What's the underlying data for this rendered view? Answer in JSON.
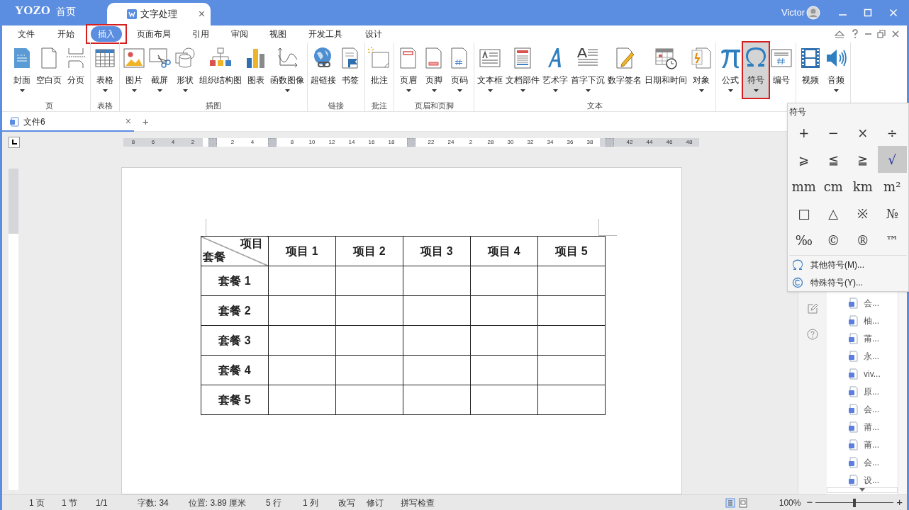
{
  "title_bar": {
    "logo": "YOZO",
    "home": "首页",
    "tab": {
      "title": "文字处理",
      "close": "×"
    },
    "user": "Victor"
  },
  "menu": [
    {
      "label": "文件",
      "selected": false,
      "outlined": false
    },
    {
      "label": "开始",
      "selected": false,
      "outlined": false
    },
    {
      "label": "插入",
      "selected": true,
      "outlined": true
    },
    {
      "label": "页面布局",
      "selected": false,
      "outlined": false
    },
    {
      "label": "引用",
      "selected": false,
      "outlined": false
    },
    {
      "label": "审阅",
      "selected": false,
      "outlined": false
    },
    {
      "label": "视图",
      "selected": false,
      "outlined": false
    },
    {
      "label": "开发工具",
      "selected": false,
      "outlined": false
    },
    {
      "label": "设计",
      "selected": false,
      "outlined": false
    }
  ],
  "ribbon": [
    {
      "label": "页",
      "buttons": [
        {
          "label": "封面",
          "dropdown": true,
          "selected": false
        },
        {
          "label": "空白页",
          "dropdown": false,
          "selected": false
        },
        {
          "label": "分页",
          "dropdown": false,
          "selected": false
        }
      ]
    },
    {
      "label": "表格",
      "buttons": [
        {
          "label": "表格",
          "dropdown": true,
          "selected": false
        }
      ]
    },
    {
      "label": "插图",
      "buttons": [
        {
          "label": "图片",
          "dropdown": true,
          "selected": false
        },
        {
          "label": "截屏",
          "dropdown": true,
          "selected": false
        },
        {
          "label": "形状",
          "dropdown": true,
          "selected": false
        },
        {
          "label": "组织结构图",
          "dropdown": false,
          "selected": false
        },
        {
          "label": "图表",
          "dropdown": false,
          "selected": false
        },
        {
          "label": "函数图像",
          "dropdown": true,
          "selected": false
        }
      ]
    },
    {
      "label": "链接",
      "buttons": [
        {
          "label": "超链接",
          "dropdown": false,
          "selected": false
        },
        {
          "label": "书签",
          "dropdown": false,
          "selected": false
        }
      ]
    },
    {
      "label": "批注",
      "buttons": [
        {
          "label": "批注",
          "dropdown": false,
          "selected": false
        }
      ]
    },
    {
      "label": "页眉和页脚",
      "buttons": [
        {
          "label": "页眉",
          "dropdown": true,
          "selected": false
        },
        {
          "label": "页脚",
          "dropdown": true,
          "selected": false
        },
        {
          "label": "页码",
          "dropdown": true,
          "selected": false
        }
      ]
    },
    {
      "label": "文本",
      "buttons": [
        {
          "label": "文本框",
          "dropdown": true,
          "selected": false
        },
        {
          "label": "文档部件",
          "dropdown": true,
          "selected": false
        },
        {
          "label": "艺术字",
          "dropdown": true,
          "selected": false
        },
        {
          "label": "首字下沉",
          "dropdown": true,
          "selected": false
        },
        {
          "label": "数字签名",
          "dropdown": false,
          "selected": false
        },
        {
          "label": "日期和时间",
          "dropdown": false,
          "selected": false
        },
        {
          "label": "对象",
          "dropdown": true,
          "selected": false
        }
      ]
    },
    {
      "buttons": [
        {
          "label": "公式",
          "dropdown": true,
          "selected": false
        },
        {
          "label": "符号",
          "dropdown": true,
          "selected": true
        },
        {
          "label": "编号",
          "dropdown": false,
          "selected": false
        }
      ]
    },
    {
      "buttons": [
        {
          "label": "视频",
          "dropdown": false,
          "selected": false
        },
        {
          "label": "音频",
          "dropdown": true,
          "selected": false
        }
      ]
    }
  ],
  "doc_tab": {
    "title": "文件6",
    "close": "×",
    "add": "+"
  },
  "ruler": [
    "8",
    "6",
    "4",
    "2",
    "2",
    "4",
    "8",
    "10",
    "12",
    "14",
    "16",
    "18",
    "22",
    "24",
    "2",
    "28",
    "30",
    "32",
    "34",
    "36",
    "38",
    "42",
    "44",
    "46",
    "48"
  ],
  "table": {
    "corner_top": "项目",
    "corner_bottom": "套餐",
    "columns": [
      "项目 1",
      "项目 2",
      "项目 3",
      "项目 4",
      "项目 5"
    ],
    "rows": [
      "套餐 1",
      "套餐 2",
      "套餐 3",
      "套餐 4",
      "套餐 5"
    ]
  },
  "symbol_menu": {
    "title": "符号",
    "symbols": [
      {
        "char": "+",
        "hovered": false
      },
      {
        "char": "−",
        "hovered": false
      },
      {
        "char": "×",
        "hovered": false
      },
      {
        "char": "÷",
        "hovered": false
      },
      {
        "char": "⩾",
        "hovered": false
      },
      {
        "char": "≦",
        "hovered": false
      },
      {
        "char": "≧",
        "hovered": false
      },
      {
        "char": "√",
        "hovered": true
      },
      {
        "char": "mm",
        "hovered": false
      },
      {
        "char": "cm",
        "hovered": false
      },
      {
        "char": "km",
        "hovered": false
      },
      {
        "char": "m²",
        "hovered": false
      },
      {
        "char": "□",
        "hovered": false
      },
      {
        "char": "△",
        "hovered": false
      },
      {
        "char": "※",
        "hovered": false
      },
      {
        "char": "№",
        "hovered": false
      },
      {
        "char": "‰",
        "hovered": false
      },
      {
        "char": "©",
        "hovered": false
      },
      {
        "char": "®",
        "hovered": false
      },
      {
        "char": "™",
        "hovered": false
      }
    ],
    "items": [
      "其他符号(M)...",
      "特殊符号(Y)..."
    ]
  },
  "files": [
    "会...",
    "柚...",
    "莆...",
    "永...",
    "viv...",
    "原...",
    "会...",
    "莆...",
    "莆...",
    "会...",
    "设..."
  ],
  "status_bar": {
    "fields": [
      "1 页",
      "1 节",
      "1/1",
      "字数: 34",
      "位置: 3.89 厘米",
      "5 行",
      "1 列",
      "改写",
      "修订",
      "拼写检查"
    ],
    "zoom": "100%",
    "zoom_out": "−",
    "zoom_in": "+",
    "zoom_slider": {
      "level": 0.5
    }
  }
}
